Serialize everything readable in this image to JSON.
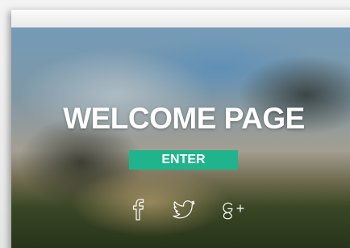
{
  "hero": {
    "title": "WELCOME PAGE",
    "enter_label": "ENTER",
    "accent_color": "#1fb48c"
  },
  "socials": [
    {
      "icon": "facebook-icon"
    },
    {
      "icon": "twitter-icon"
    },
    {
      "icon": "google-plus-icon"
    }
  ]
}
